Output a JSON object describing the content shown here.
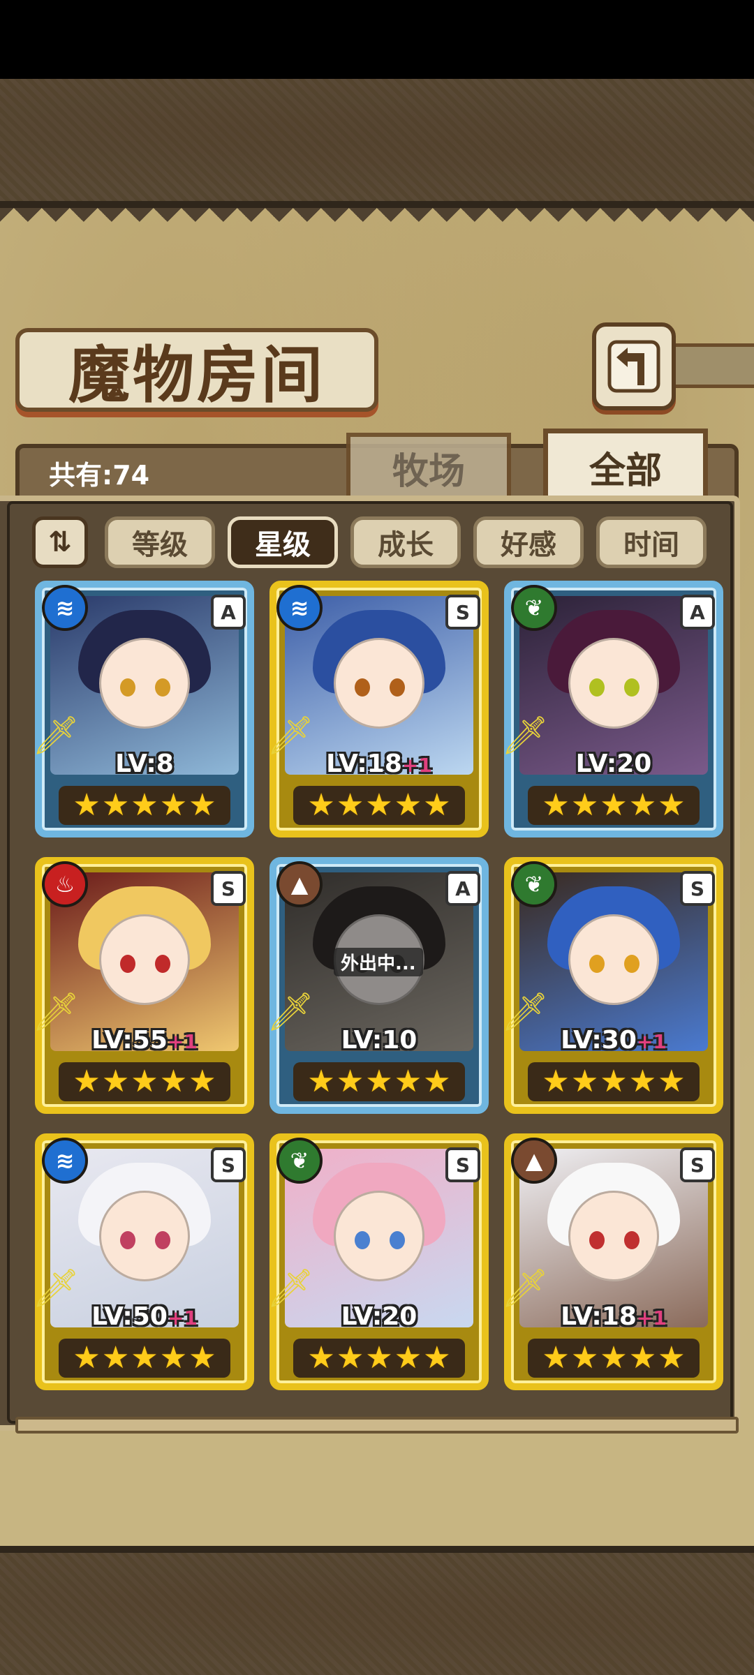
{
  "screen": {
    "title": "魔物房间",
    "count_label": "共有:74",
    "tabs": [
      {
        "label": "牧场",
        "active": false
      },
      {
        "label": "全部",
        "active": true
      }
    ],
    "sort_toggle_icon": "sort-direction-icon",
    "sort_buttons": [
      {
        "label": "等级",
        "active": false
      },
      {
        "label": "星级",
        "active": true
      },
      {
        "label": "成长",
        "active": false
      },
      {
        "label": "好感",
        "active": false
      },
      {
        "label": "时间",
        "active": false
      }
    ]
  },
  "monsters": [
    {
      "element": "water",
      "element_icon": "water-element-icon",
      "rank": "A",
      "level": "LV:8",
      "bonus": "",
      "stars": 5,
      "frame": "blue",
      "status": ""
    },
    {
      "element": "water",
      "element_icon": "water-element-icon",
      "rank": "S",
      "level": "LV:18",
      "bonus": "+1",
      "stars": 5,
      "frame": "gold",
      "status": ""
    },
    {
      "element": "wood",
      "element_icon": "leaf-element-icon",
      "rank": "A",
      "level": "LV:20",
      "bonus": "",
      "stars": 5,
      "frame": "blue",
      "status": ""
    },
    {
      "element": "fire",
      "element_icon": "fire-element-icon",
      "rank": "S",
      "level": "LV:55",
      "bonus": "+1",
      "stars": 5,
      "frame": "gold",
      "status": ""
    },
    {
      "element": "earth",
      "element_icon": "earth-element-icon",
      "rank": "A",
      "level": "LV:10",
      "bonus": "",
      "stars": 5,
      "frame": "blue",
      "status": "外出中..."
    },
    {
      "element": "wood",
      "element_icon": "leaf-element-icon",
      "rank": "S",
      "level": "LV:30",
      "bonus": "+1",
      "stars": 5,
      "frame": "gold",
      "status": ""
    },
    {
      "element": "water",
      "element_icon": "water-element-icon",
      "rank": "S",
      "level": "LV:50",
      "bonus": "+1",
      "stars": 5,
      "frame": "gold",
      "status": ""
    },
    {
      "element": "wood",
      "element_icon": "leaf-element-icon",
      "rank": "S",
      "level": "LV:20",
      "bonus": "",
      "stars": 5,
      "frame": "gold",
      "status": ""
    },
    {
      "element": "earth",
      "element_icon": "earth-element-icon",
      "rank": "S",
      "level": "LV:18",
      "bonus": "+1",
      "stars": 5,
      "frame": "gold",
      "status": ""
    }
  ],
  "colors": {
    "element": {
      "water": "#1f6fd1",
      "wood": "#2f7a2f",
      "fire": "#c82020",
      "earth": "#7a4a30"
    },
    "frame_blue": "#6fb6e0",
    "frame_gold": "#e9c21c"
  },
  "icons": {
    "back_button": "back-arrow-icon",
    "sword": "sword-icon",
    "star": "star-icon"
  }
}
